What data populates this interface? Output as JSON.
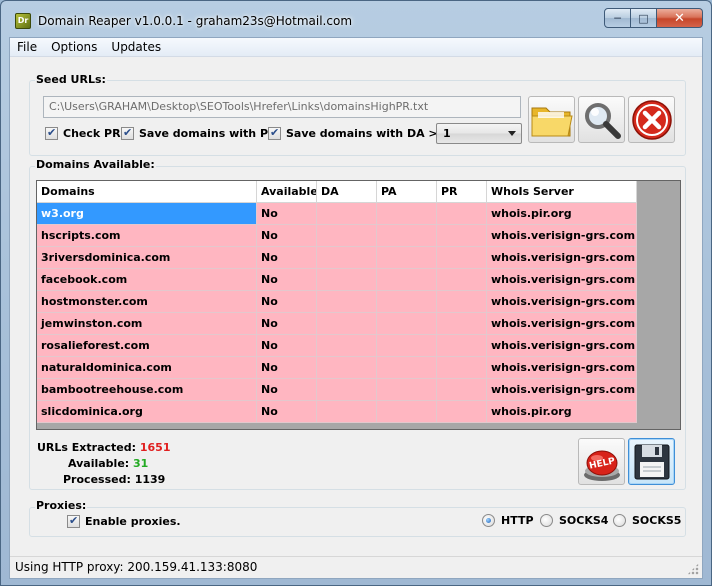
{
  "window": {
    "title": "Domain Reaper v1.0.0.1 - graham23s@Hotmail.com",
    "icon_label": "Dr"
  },
  "menu": [
    "File",
    "Options",
    "Updates"
  ],
  "seed": {
    "label": "Seed URLs:",
    "path": "C:\\Users\\GRAHAM\\Desktop\\SEOTools\\Hrefer\\Links\\domainsHighPR.txt",
    "check_pr": "Check PR.",
    "save_pr": "Save domains with PR.",
    "save_da": "Save domains with DA >=",
    "da_value": "1"
  },
  "buttons": {
    "open": "folder-icon",
    "search": "magnifier-icon",
    "stop": "stop-icon",
    "help": "help-icon",
    "save": "floppy-disk-icon"
  },
  "domains": {
    "label": "Domains Available:",
    "columns": [
      "Domains",
      "Available",
      "DA",
      "PA",
      "PR",
      "WhoIs Server"
    ],
    "rows": [
      [
        "w3.org",
        "No",
        "",
        "",
        "",
        "whois.pir.org"
      ],
      [
        "hscripts.com",
        "No",
        "",
        "",
        "",
        "whois.verisign-grs.com"
      ],
      [
        "3riversdominica.com",
        "No",
        "",
        "",
        "",
        "whois.verisign-grs.com"
      ],
      [
        "facebook.com",
        "No",
        "",
        "",
        "",
        "whois.verisign-grs.com"
      ],
      [
        "hostmonster.com",
        "No",
        "",
        "",
        "",
        "whois.verisign-grs.com"
      ],
      [
        "jemwinston.com",
        "No",
        "",
        "",
        "",
        "whois.verisign-grs.com"
      ],
      [
        "rosalieforest.com",
        "No",
        "",
        "",
        "",
        "whois.verisign-grs.com"
      ],
      [
        "naturaldominica.com",
        "No",
        "",
        "",
        "",
        "whois.verisign-grs.com"
      ],
      [
        "bambootreehouse.com",
        "No",
        "",
        "",
        "",
        "whois.verisign-grs.com"
      ],
      [
        "slicdominica.org",
        "No",
        "",
        "",
        "",
        "whois.pir.org"
      ]
    ]
  },
  "stats": {
    "extracted_label": "URLs Extracted:",
    "extracted": "1651",
    "available_label": "Available:",
    "available": "31",
    "processed_label": "Processed:",
    "processed": "1139"
  },
  "proxies": {
    "label": "Proxies:",
    "enable": "Enable proxies.",
    "http": "HTTP",
    "socks4": "SOCKS4",
    "socks5": "SOCKS5",
    "selected": "HTTP"
  },
  "status": "Using HTTP proxy: 200.159.41.133:8080",
  "colors": {
    "row_bg": "#ffb6c1",
    "selected_bg": "#3399ff",
    "extracted": "#e02020",
    "available": "#22aa22"
  }
}
